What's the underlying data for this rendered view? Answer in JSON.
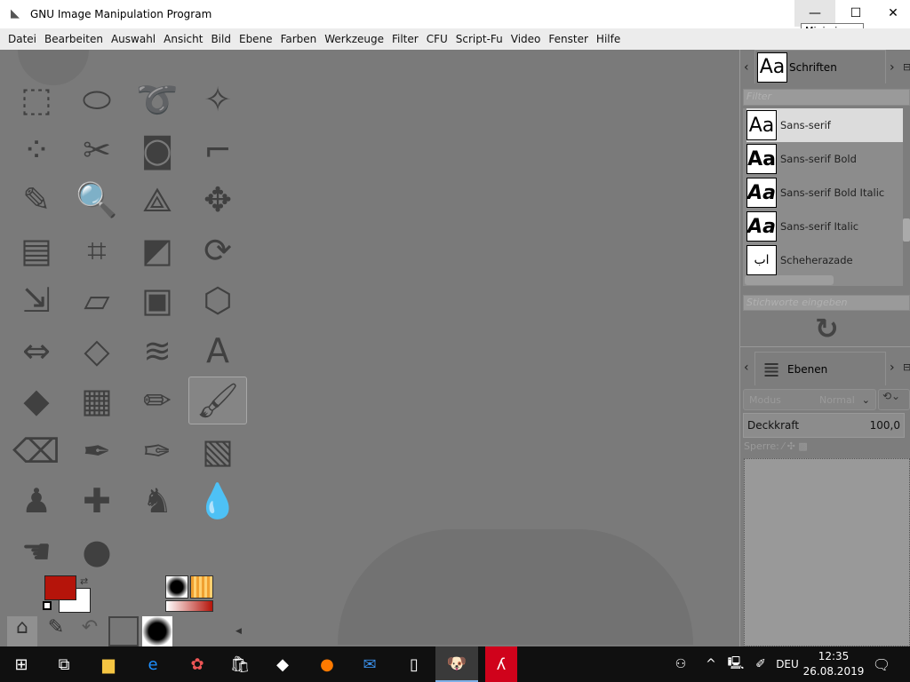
{
  "window": {
    "title": "GNU Image Manipulation Program",
    "minimize_tooltip": "Minimieren",
    "minimize": "—",
    "maximize": "☐",
    "close": "✕"
  },
  "menu": [
    "Datei",
    "Bearbeiten",
    "Auswahl",
    "Ansicht",
    "Bild",
    "Ebene",
    "Farben",
    "Werkzeuge",
    "Filter",
    "CFU",
    "Script-Fu",
    "Video",
    "Fenster",
    "Hilfe"
  ],
  "tools": [
    [
      "rect-select-icon",
      "⬚"
    ],
    [
      "ellipse-select-icon",
      "⬭"
    ],
    [
      "free-select-icon",
      "➰"
    ],
    [
      "fuzzy-select-icon",
      "✧"
    ],
    [
      "color-select-icon",
      "⁘"
    ],
    [
      "scissors-icon",
      "✂"
    ],
    [
      "foreground-select-icon",
      "◙"
    ],
    [
      "paths-icon",
      "⌐"
    ],
    [
      "color-picker-icon",
      "✎"
    ],
    [
      "zoom-icon",
      "🔍"
    ],
    [
      "measure-icon",
      "⟁"
    ],
    [
      "move-icon",
      "✥"
    ],
    [
      "align-icon",
      "▤"
    ],
    [
      "crop-icon",
      "⌗"
    ],
    [
      "unified-transform-icon",
      "◩"
    ],
    [
      "rotate-icon",
      "⟳"
    ],
    [
      "scale-icon",
      "⇲"
    ],
    [
      "shear-icon",
      "▱"
    ],
    [
      "cage-icon",
      "▣"
    ],
    [
      "perspective-icon",
      "⬡"
    ],
    [
      "flip-icon",
      "⇔"
    ],
    [
      "warp-icon",
      "◇"
    ],
    [
      "wave-icon",
      "≋"
    ],
    [
      "text-icon",
      "A"
    ],
    [
      "bucket-fill-icon",
      "◆"
    ],
    [
      "blend-icon",
      "▦"
    ],
    [
      "pencil-icon",
      "✏"
    ],
    [
      "paintbrush-icon",
      "🖌"
    ],
    [
      "eraser-icon",
      "⌫"
    ],
    [
      "airbrush-icon",
      "✒"
    ],
    [
      "ink-icon",
      "✑"
    ],
    [
      "mypaint-icon",
      "▧"
    ],
    [
      "clone-icon",
      "♟"
    ],
    [
      "heal-icon",
      "✚"
    ],
    [
      "perspective-clone-icon",
      "♞"
    ],
    [
      "blur-icon",
      "💧"
    ],
    [
      "smudge-icon",
      "☚"
    ],
    [
      "dodge-burn-icon",
      "●"
    ]
  ],
  "colors": {
    "foreground": "#b5140a",
    "background": "#ffffff"
  },
  "fonts_dock": {
    "tab_label": "Schriften",
    "tab_preview": "Aa",
    "filter_placeholder": "Filter",
    "tags_placeholder": "Stichworte eingeben",
    "items": [
      {
        "preview": "Aa",
        "name": "Sans-serif"
      },
      {
        "preview": "Aa",
        "name": "Sans-serif Bold"
      },
      {
        "preview": "Aa",
        "name": "Sans-serif Bold Italic"
      },
      {
        "preview": "Aa",
        "name": "Sans-serif Italic"
      },
      {
        "preview": "اب",
        "name": "Scheherazade"
      }
    ]
  },
  "layers_dock": {
    "tab_label": "Ebenen",
    "mode_label": "Modus",
    "mode_value": "Normal",
    "opacity_label": "Deckkraft",
    "opacity_value": "100,0",
    "lock_label": "Sperre:"
  },
  "taskbar": {
    "language": "DEU",
    "time": "12:35",
    "date": "26.08.2019"
  }
}
